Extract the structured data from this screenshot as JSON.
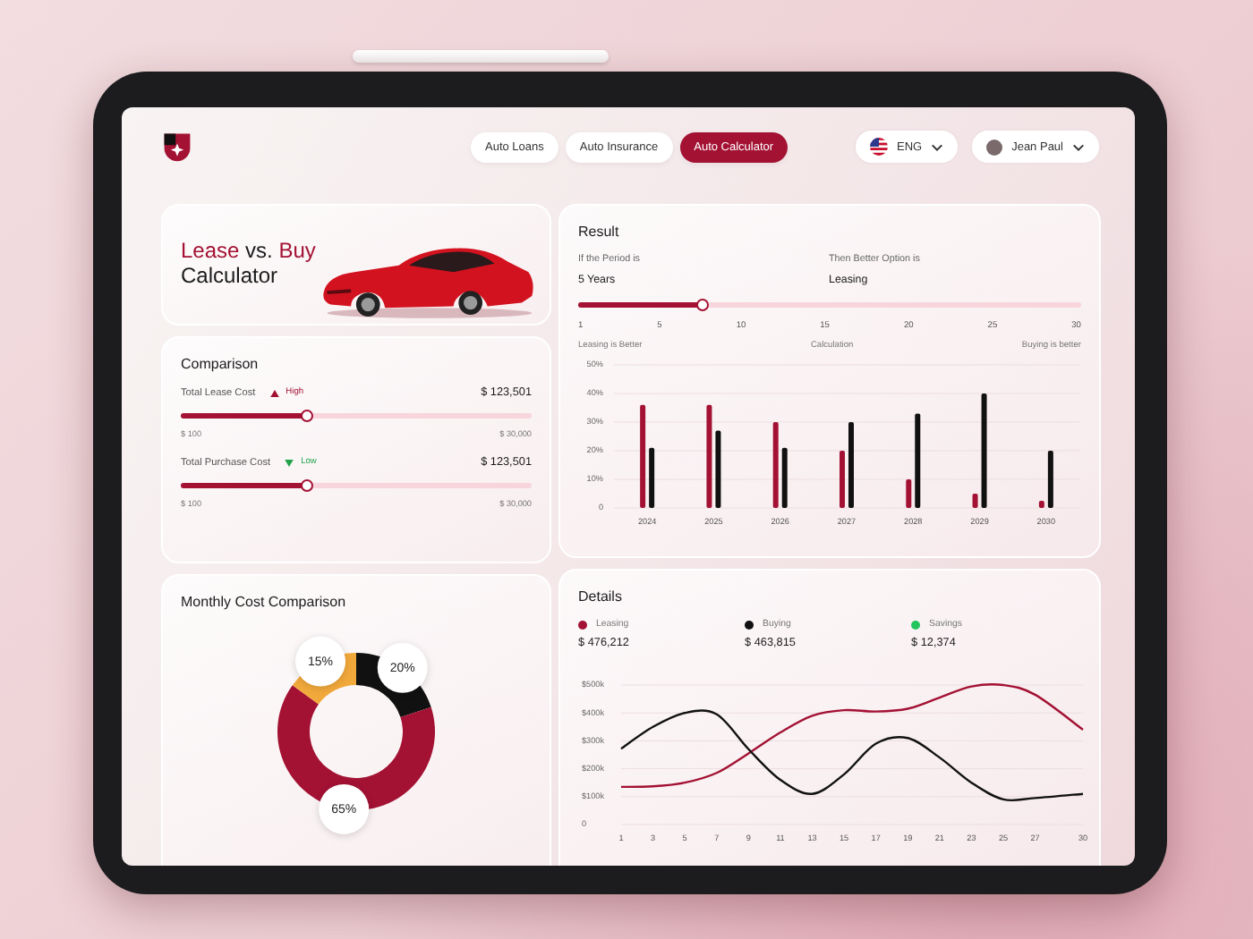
{
  "header": {
    "nav": [
      {
        "label": "Auto Loans",
        "selected": false
      },
      {
        "label": "Auto Insurance",
        "selected": false
      },
      {
        "label": "Auto Calculator",
        "selected": true
      }
    ],
    "language": "ENG",
    "user": "Jean Paul"
  },
  "hero": {
    "title_lines": [
      [
        {
          "text": "Lease",
          "accent": true
        },
        {
          "text": "vs.",
          "accent": false
        },
        {
          "text": "Buy",
          "accent": true
        }
      ],
      [
        {
          "text": "Calculator",
          "accent": false
        }
      ]
    ]
  },
  "comparison": {
    "title": "Comparison",
    "items": [
      {
        "label": "Total Lease Cost",
        "kind": "up",
        "trend_label": "High",
        "value": "$ 123,501",
        "level": 0.36,
        "min": "$ 100",
        "max": "$ 30,000"
      },
      {
        "label": "Total Purchase Cost",
        "kind": "down",
        "trend_label": "Low",
        "value": "$ 123,501",
        "level": 0.36,
        "min": "$ 100",
        "max": "$ 30,000"
      }
    ]
  },
  "monthly": {
    "title": "Monthly Cost Comparison",
    "chart_data": {
      "type": "donut",
      "values": [
        20,
        65,
        15
      ],
      "colors": [
        "#111111",
        "#a31133",
        "#f2a93b"
      ],
      "value_labels": [
        "20%",
        "65%",
        "15%"
      ]
    }
  },
  "result": {
    "title": "Result",
    "period_label": "If the Period is",
    "period_value": "5 Years",
    "option_label": "Then Better Option is",
    "option_value": "Leasing",
    "slider": {
      "level": 0.25,
      "ticks": [
        "1",
        "5",
        "10",
        "15",
        "20",
        "25",
        "30"
      ]
    },
    "captions": [
      "Leasing is Better",
      "Calculation",
      "Buying is better"
    ],
    "chart_data": {
      "type": "bar",
      "categories": [
        "2024",
        "2025",
        "2026",
        "2027",
        "2028",
        "2029",
        "2030"
      ],
      "series": [
        {
          "color": "#a31133",
          "values": [
            36,
            36,
            30,
            20,
            10,
            5,
            2.5
          ]
        },
        {
          "color": "#111111",
          "values": [
            21,
            27,
            21,
            30,
            33,
            40,
            20
          ]
        }
      ],
      "ylim": [
        0,
        50
      ],
      "grid": true,
      "yticks": [
        {
          "value": 0,
          "label": "0"
        },
        {
          "value": 10,
          "label": "10%"
        },
        {
          "value": 20,
          "label": "20%"
        },
        {
          "value": 30,
          "label": "30%"
        },
        {
          "value": 40,
          "label": "40%"
        },
        {
          "value": 50,
          "label": "50%"
        }
      ]
    }
  },
  "details": {
    "title": "Details",
    "legend": [
      {
        "label": "Leasing",
        "value": "$ 476,212",
        "color": "#a31133"
      },
      {
        "label": "Buying",
        "value": "$ 463,815",
        "color": "#111111"
      },
      {
        "label": "Savings",
        "value": "$ 12,374",
        "color": "#22c55e"
      }
    ],
    "chart_data": {
      "type": "line",
      "x": [
        1,
        3,
        5,
        7,
        9,
        11,
        13,
        15,
        17,
        19,
        21,
        23,
        25,
        27,
        30
      ],
      "series": [
        {
          "color": "#a31133",
          "values": [
            135,
            137,
            150,
            185,
            255,
            330,
            390,
            410,
            405,
            415,
            455,
            495,
            500,
            465,
            340
          ]
        },
        {
          "color": "#111111",
          "values": [
            272,
            350,
            400,
            395,
            270,
            160,
            110,
            180,
            290,
            310,
            240,
            150,
            90,
            95,
            110
          ]
        }
      ],
      "xlim": [
        1,
        30
      ],
      "grid": true,
      "ylim": [
        0,
        500
      ],
      "xticks": [
        1,
        3,
        5,
        7,
        9,
        11,
        13,
        15,
        17,
        19,
        21,
        23,
        25,
        27,
        30
      ],
      "yticks": [
        {
          "value": 0,
          "label": "0"
        },
        {
          "value": 100,
          "label": "$100k"
        },
        {
          "value": 200,
          "label": "$200k"
        },
        {
          "value": 300,
          "label": "$300k"
        },
        {
          "value": 400,
          "label": "$400k"
        },
        {
          "value": 500,
          "label": "$500k"
        }
      ]
    }
  }
}
